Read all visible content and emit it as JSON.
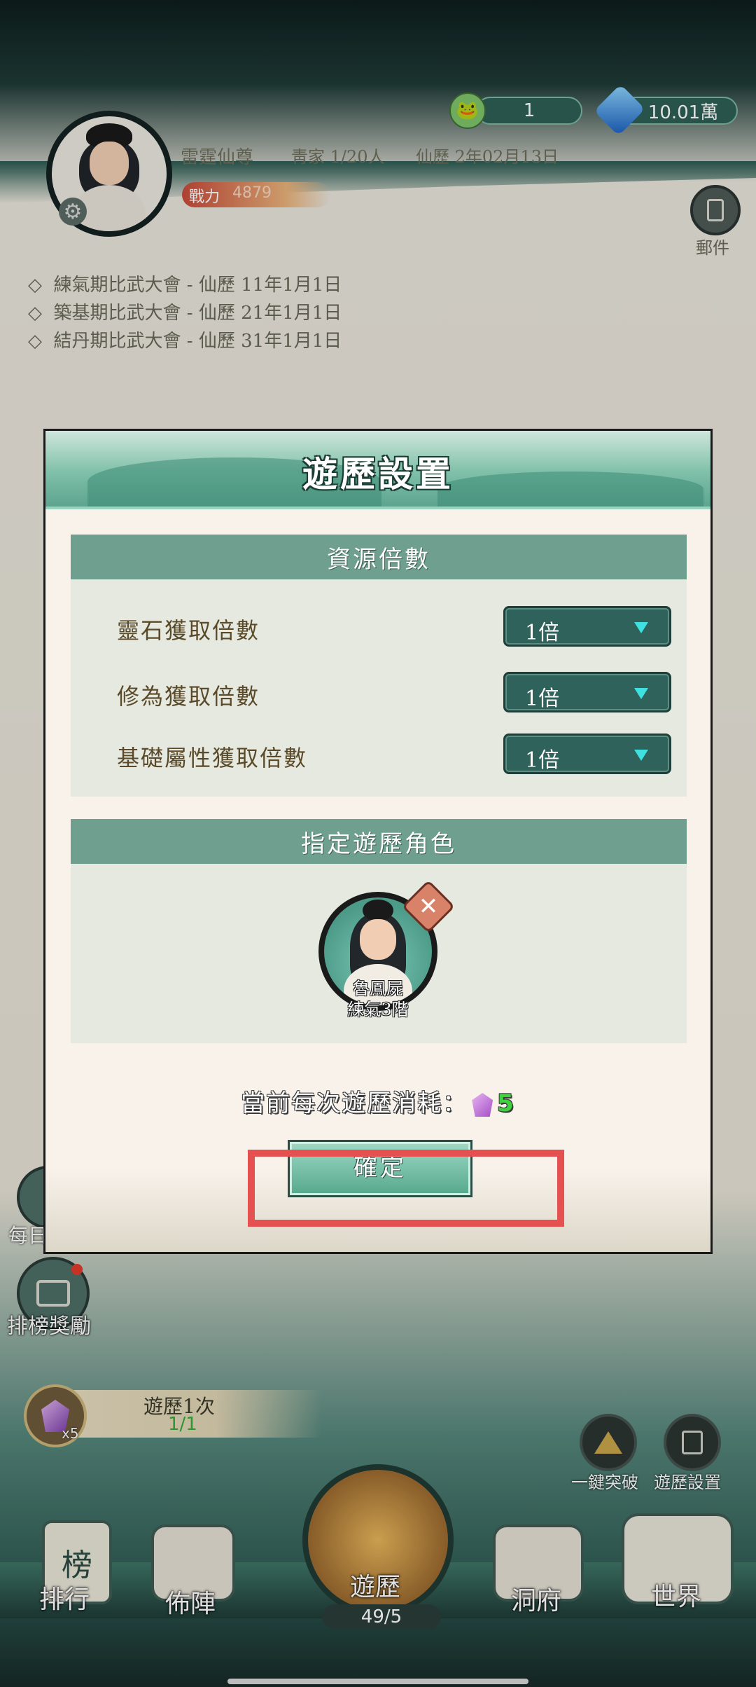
{
  "top_bar": {
    "frog_count": "1",
    "gem_balance": "10.01萬"
  },
  "profile": {
    "name": "雷霆仙尊",
    "clan": "靑家 1/20人",
    "calendar": "仙歷 2年02月13日",
    "power_label": "戰力",
    "power_value": "4879"
  },
  "right_mail_label": "郵件",
  "announcements": [
    "練氣期比武大會 - 仙歷 11年1月1日",
    "築基期比武大會 - 仙歷 21年1月1日",
    "結丹期比武大會 - 仙歷 31年1月1日"
  ],
  "left_side": {
    "daily_label": "每日",
    "ranking_reward_label": "排榜獎勵"
  },
  "travel_counter": {
    "gem_multiplier": "x5",
    "title": "遊歷1次",
    "progress": "1/1"
  },
  "right_tools": {
    "one_click_label": "一鍵突破",
    "settings_label": "遊歷設置"
  },
  "bottom_nav": {
    "ranking": "排行",
    "formation": "佈陣",
    "travel": "遊歷",
    "travel_count": "49/5",
    "cave": "洞府",
    "world": "世界"
  },
  "dialog": {
    "title": "遊歷設置",
    "resource_section": "資源倍數",
    "rows": [
      {
        "label": "靈石獲取倍數",
        "value": "1倍"
      },
      {
        "label": "修為獲取倍數",
        "value": "1倍"
      },
      {
        "label": "基礎屬性獲取倍數",
        "value": "1倍"
      }
    ],
    "role_section": "指定遊歷角色",
    "character_name": "魯鳳屍",
    "character_realm": "練氣3階",
    "cost_label": "當前每次遊歷消耗：",
    "cost_value": "5",
    "confirm": "確定"
  },
  "colors": {
    "highlight": "#e55050",
    "section_header": "#6e9f8f",
    "dropdown": "#2f625a",
    "cost_green": "#3fd23f"
  }
}
